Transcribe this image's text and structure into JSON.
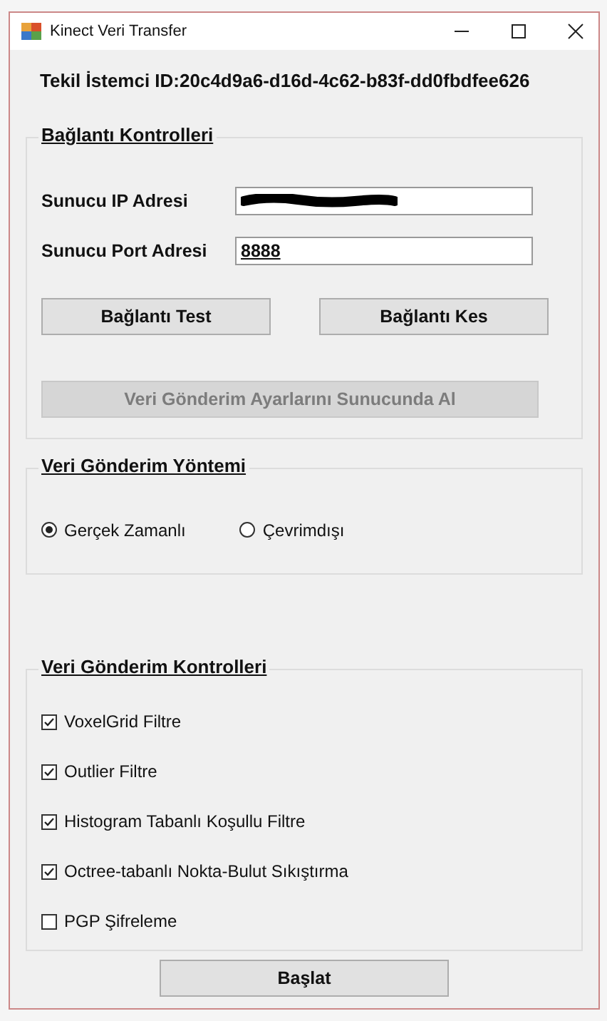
{
  "window": {
    "title": "Kinect Veri Transfer"
  },
  "client_id": "Tekil İstemci ID:20c4d9a6-d16d-4c62-b83f-dd0fbdfee626",
  "connection": {
    "title": "Bağlantı Kontrolleri",
    "fields": [
      {
        "label": "Sunucu IP Adresi",
        "redacted": true
      },
      {
        "label": "Sunucu Port Adresi",
        "value": "8888",
        "redacted": false
      }
    ],
    "buttons": [
      {
        "label": "Bağlantı Test",
        "disabled": false
      },
      {
        "label": "Bağlantı Kes",
        "disabled": false
      }
    ],
    "settings_button": {
      "label": "Veri Gönderim Ayarlarını Sunucunda Al",
      "disabled": true
    }
  },
  "method": {
    "title": "Veri Gönderim Yöntemi",
    "options": [
      {
        "label": "Gerçek Zamanlı",
        "selected": true
      },
      {
        "label": "Çevrimdışı",
        "selected": false
      }
    ]
  },
  "controls": {
    "title": "Veri Gönderim Kontrolleri",
    "options": [
      {
        "label": "VoxelGrid Filtre",
        "checked": true
      },
      {
        "label": "Outlier Filtre",
        "checked": true
      },
      {
        "label": "Histogram Tabanlı Koşullu Filtre",
        "checked": true
      },
      {
        "label": "Octree-tabanlı Nokta-Bulut Sıkıştırma",
        "checked": true
      },
      {
        "label": "PGP Şifreleme",
        "checked": false
      }
    ]
  },
  "start_button": {
    "label": "Başlat"
  }
}
